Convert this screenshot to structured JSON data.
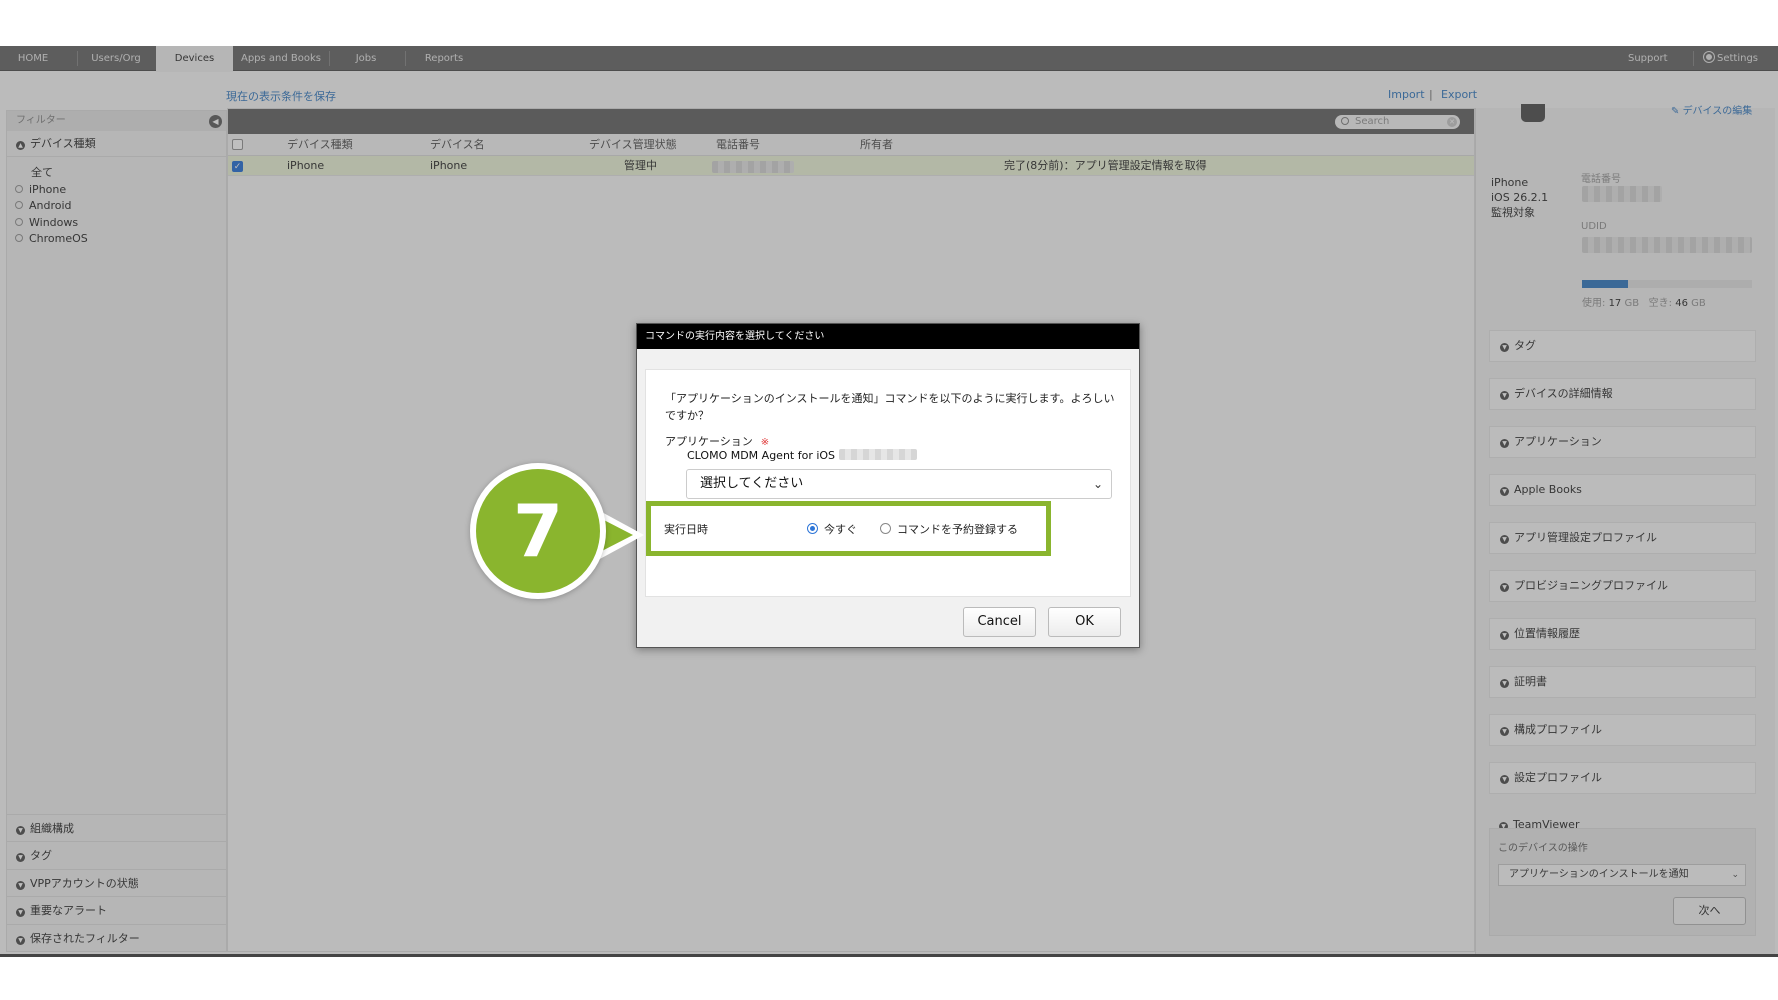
{
  "nav": {
    "tabs": [
      "HOME",
      "Users/Org",
      "Devices",
      "Apps and Books",
      "Jobs",
      "Reports"
    ],
    "support": "Support",
    "settings": "Settings"
  },
  "links": {
    "save_view": "現在の表示条件を保存",
    "import": "Import",
    "separator": "|",
    "export": "Export"
  },
  "sidebar": {
    "header": "フィルター",
    "section_device_type": "デバイス種類",
    "device_types": [
      "全て",
      "iPhone",
      "Android",
      "Windows",
      "ChromeOS"
    ],
    "bottom_sections": [
      "組織構成",
      "タグ",
      "VPPアカウントの状態",
      "重要なアラート",
      "保存されたフィルター"
    ]
  },
  "search": {
    "placeholder": "Search"
  },
  "table": {
    "headers": [
      "デバイス種類",
      "デバイス名",
      "デバイス管理状態",
      "電話番号",
      "所有者"
    ],
    "row": {
      "type": "iPhone",
      "name": "iPhone",
      "status": "管理中",
      "job": "完了(8分前)：アプリ管理設定情報を取得"
    }
  },
  "right_panel": {
    "edit_link": "デバイスの編集",
    "model": "iPhone",
    "os": "iOS 26.2.1",
    "supervised": "監視対象",
    "phone_label": "電話番号",
    "udid_label": "UDID",
    "storage_used_label": "使用:",
    "storage_used_value": "17",
    "storage_free_label": "空き:",
    "storage_free_value": "46",
    "storage_unit": "GB",
    "storage_used_fraction": 0.27,
    "sections": [
      "タグ",
      "デバイスの詳細情報",
      "アプリケーション",
      "Apple Books",
      "アプリ管理設定プロファイル",
      "プロビジョニングプロファイル",
      "位置情報履歴",
      "証明書",
      "構成プロファイル",
      "設定プロファイル",
      "TeamViewer"
    ],
    "ops_title": "このデバイスの操作",
    "ops_selected": "アプリケーションのインストールを通知",
    "next_button": "次へ"
  },
  "dialog": {
    "title": "コマンドの実行内容を選択してください",
    "message": "「アプリケーションのインストールを通知」コマンドを以下のように実行します。よろしいですか？",
    "app_label": "アプリケーション",
    "required_mark": "※",
    "app_value": "CLOMO MDM Agent for iOS",
    "select_placeholder": "選択してください",
    "exec_label": "実行日時",
    "option_now": "今すぐ",
    "option_schedule": "コマンドを予約登録する",
    "cancel": "Cancel",
    "ok": "OK"
  },
  "callout": {
    "number": "7"
  },
  "colors": {
    "accent_green": "#8ab52e",
    "link_blue": "#3b7fc4",
    "nav_bg": "#6e6e6e"
  }
}
